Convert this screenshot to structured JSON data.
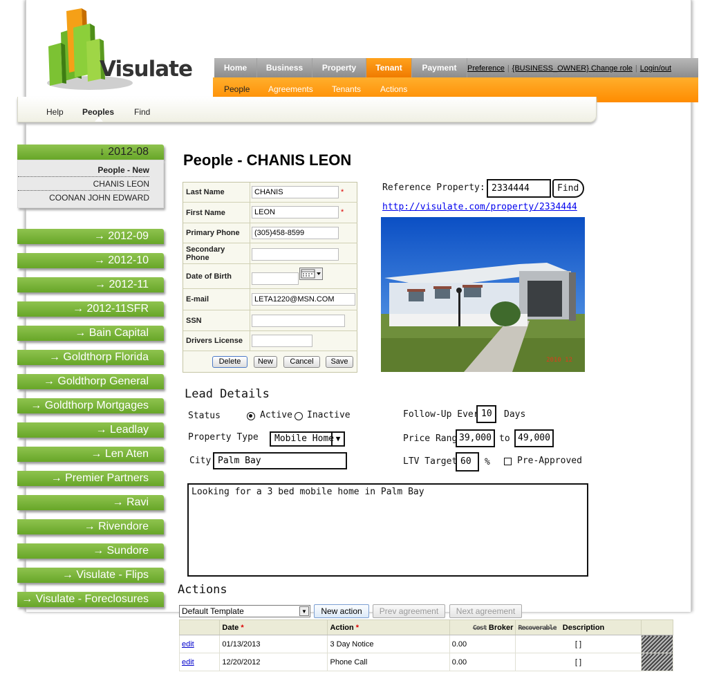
{
  "brand": {
    "name": "Visulate"
  },
  "top_nav": {
    "tabs": [
      "Home",
      "Business",
      "Property",
      "Tenant",
      "Payment"
    ],
    "active": "Tenant",
    "links": {
      "preference": "Preference",
      "role": "{BUSINESS_OWNER} Change role",
      "logout": "Login/out"
    }
  },
  "sub_nav": {
    "items": [
      "People",
      "Agreements",
      "Tenants",
      "Actions"
    ],
    "active": "People"
  },
  "third_nav": {
    "items": [
      "Help",
      "Peoples",
      "Find"
    ],
    "active": "Peoples"
  },
  "sidebar": {
    "expanded": {
      "label": "↓ 2012-08",
      "items": [
        "People - New",
        "CHANIS LEON",
        "COONAN JOHN EDWARD"
      ]
    },
    "groups": [
      "→ 2012-09",
      "→ 2012-10",
      "→ 2012-11",
      "→ 2012-11SFR",
      "→ Bain Capital",
      "→ Goldthorp Florida",
      "→ Goldthorp General",
      "→ Goldthorp Mortgages",
      "→ Leadlay",
      "→ Len Aten",
      "→ Premier Partners",
      "→ Ravi",
      "→ Rivendore",
      "→ Sundore",
      "→ Visulate - Flips",
      "→ Visulate - Foreclosures"
    ]
  },
  "page_title": "People - CHANIS LEON",
  "form": {
    "last_name": {
      "label": "Last Name",
      "value": "CHANIS"
    },
    "first_name": {
      "label": "First Name",
      "value": "LEON"
    },
    "primary_phone": {
      "label": "Primary Phone",
      "value": "(305)458-8599"
    },
    "secondary_phone": {
      "label": "Secondary Phone",
      "value": ""
    },
    "dob": {
      "label": "Date of Birth",
      "value": ""
    },
    "email": {
      "label": "E-mail",
      "value": "LETA1220@MSN.COM"
    },
    "ssn": {
      "label": "SSN",
      "value": ""
    },
    "drivers_license": {
      "label": "Drivers License",
      "value": ""
    },
    "required_mark": "*",
    "buttons": {
      "delete": "Delete",
      "new": "New",
      "cancel": "Cancel",
      "save": "Save"
    }
  },
  "reference": {
    "label": "Reference Property:",
    "value": "2334444",
    "find": "Find",
    "link": "http://visulate.com/property/2334444",
    "photo_stamp": "2010 12"
  },
  "lead": {
    "heading": "Lead Details",
    "status_label": "Status",
    "active": "Active",
    "inactive": "Inactive",
    "status_value": "Active",
    "property_type_label": "Property Type",
    "property_type": "Mobile Home",
    "city_label": "City",
    "city": "Palm Bay",
    "follow_up_label": "Follow-Up Every",
    "follow_up_value": "10",
    "follow_up_unit": "Days",
    "price_label": "Price Range",
    "price_min": "39,000",
    "price_to": "to",
    "price_max": "49,000",
    "ltv_label": "LTV Target",
    "ltv_value": "60",
    "ltv_unit": "%",
    "preapproved_label": "Pre-Approved",
    "preapproved": false,
    "notes": "Looking for a 3 bed mobile home in Palm Bay"
  },
  "actions": {
    "heading": "Actions",
    "template": "Default Template",
    "new_action": "New action",
    "prev": "Prev agreement",
    "next": "Next agreement",
    "columns": {
      "date": "Date",
      "action": "Action",
      "cost_struck": "Cost",
      "broker": "Broker",
      "recoverable_struck": "Recoverable",
      "description": "Description",
      "req": "*"
    },
    "rows": [
      {
        "edit": "edit",
        "date": "01/13/2013",
        "action": "3 Day Notice",
        "amount": "0.00",
        "desc": "[ ]"
      },
      {
        "edit": "edit",
        "date": "12/20/2012",
        "action": "Phone Call",
        "amount": "0.00",
        "desc": "[ ]"
      }
    ]
  },
  "colors": {
    "orange": "#ff8c00",
    "green": "#6aa82c",
    "gray_tab": "#9a9a9a"
  }
}
